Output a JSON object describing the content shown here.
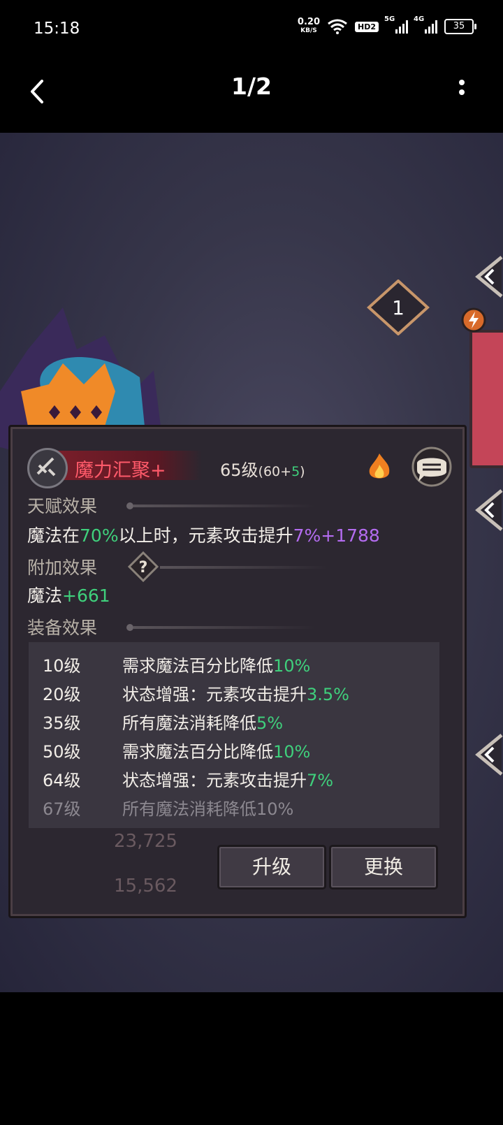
{
  "status_bar": {
    "time": "15:18",
    "net_speed": "0.20",
    "net_speed_unit": "KB/S",
    "hd": "HD2",
    "sig1": "5G",
    "sig2": "4G",
    "battery": "35"
  },
  "title_bar": {
    "page_indicator": "1/2"
  },
  "game": {
    "badge_number": "1",
    "skill": {
      "name": "魔力汇聚+",
      "level": "65级",
      "level_open": "(60+",
      "level_bonus": "5",
      "level_close": ")"
    },
    "talent": {
      "label": "天赋效果",
      "t1": "魔法在",
      "t2": "70%",
      "t3": "以上时，元素攻击提升",
      "t4": "7%+1788"
    },
    "additional": {
      "label": "附加效果",
      "t1": "魔法",
      "t2": "+661"
    },
    "equip": {
      "label": "装备效果",
      "rows": [
        {
          "level": "10级",
          "desc": "需求魔法百分比降低",
          "value": "10%"
        },
        {
          "level": "20级",
          "desc": "状态增强：元素攻击提升",
          "value": "3.5%"
        },
        {
          "level": "35级",
          "desc": "所有魔法消耗降低",
          "value": "5%"
        },
        {
          "level": "50级",
          "desc": "需求魔法百分比降低",
          "value": "10%"
        },
        {
          "level": "64级",
          "desc": "状态增强：元素攻击提升",
          "value": "7%"
        },
        {
          "level": "67级",
          "desc": "所有魔法消耗降低",
          "value": "10%"
        }
      ]
    },
    "bg_numbers": [
      "23,725",
      "15,562"
    ],
    "buttons": {
      "upgrade": "升级",
      "replace": "更换"
    }
  }
}
